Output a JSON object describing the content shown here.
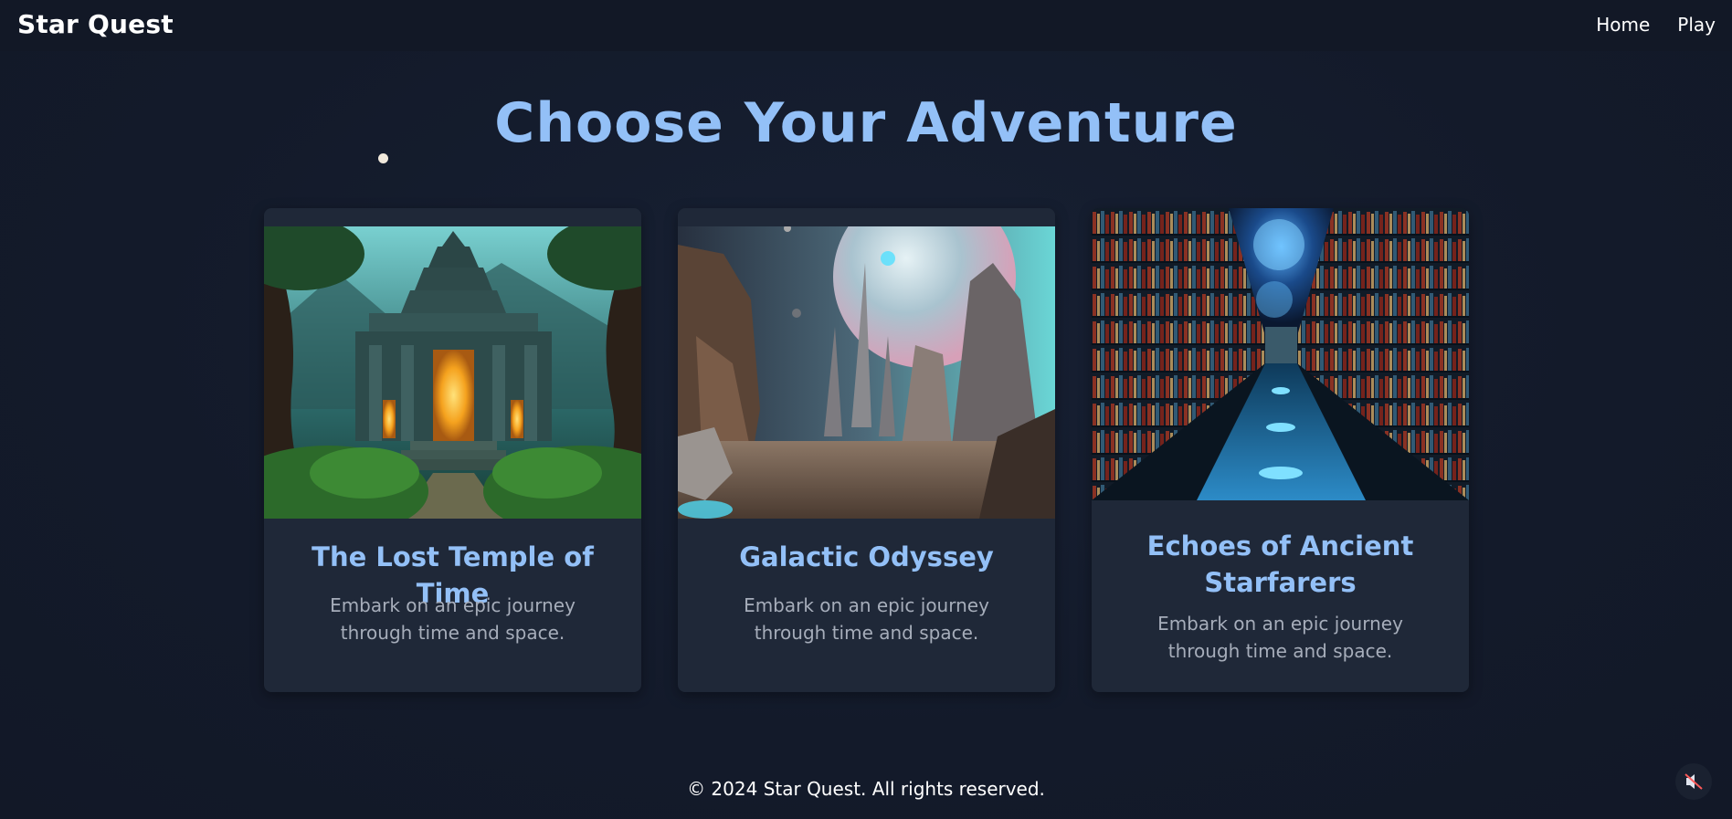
{
  "header": {
    "brand": "Star Quest",
    "nav": [
      {
        "label": "Home"
      },
      {
        "label": "Play"
      }
    ]
  },
  "main": {
    "title": "Choose Your Adventure",
    "cards": [
      {
        "title": "The Lost Temple of Time",
        "description": "Embark on an epic journey through time and space.",
        "image_icon": "jungle-temple-image"
      },
      {
        "title": "Galactic Odyssey",
        "description": "Embark on an epic journey through time and space.",
        "image_icon": "alien-planet-image"
      },
      {
        "title": "Echoes of Ancient Starfarers",
        "description": "Embark on an epic journey through time and space.",
        "image_icon": "cosmic-library-image"
      }
    ]
  },
  "footer": {
    "copyright": "© 2024 Star Quest. All rights reserved."
  },
  "colors": {
    "accent": "#93c0f7",
    "background": "#131a2a",
    "card": "#1f2838",
    "muted_text": "#a6adba"
  },
  "controls": {
    "sound_icon": "muted-speaker-icon"
  }
}
